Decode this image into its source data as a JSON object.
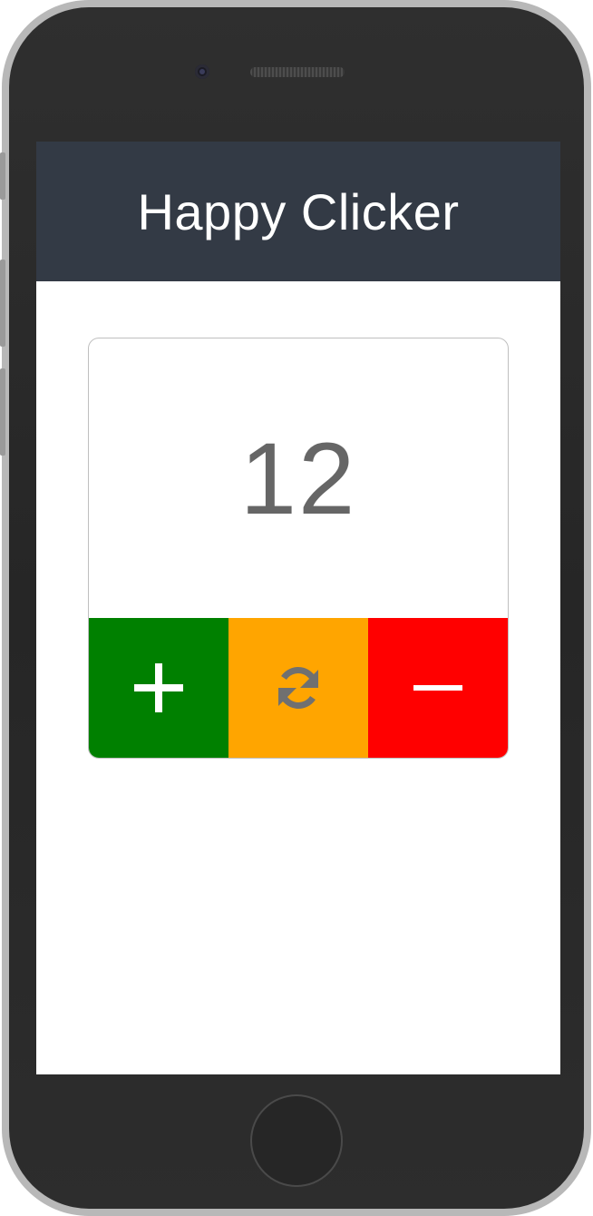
{
  "app": {
    "title": "Happy Clicker"
  },
  "counter": {
    "value": "12"
  },
  "controls": {
    "increment": {
      "icon": "plus-icon",
      "color": "#008000"
    },
    "reset": {
      "icon": "refresh-icon",
      "color": "#ffa500"
    },
    "decrement": {
      "icon": "minus-icon",
      "color": "#ff0000"
    }
  },
  "theme": {
    "header_bg": "#333a45",
    "count_color": "#666666"
  }
}
